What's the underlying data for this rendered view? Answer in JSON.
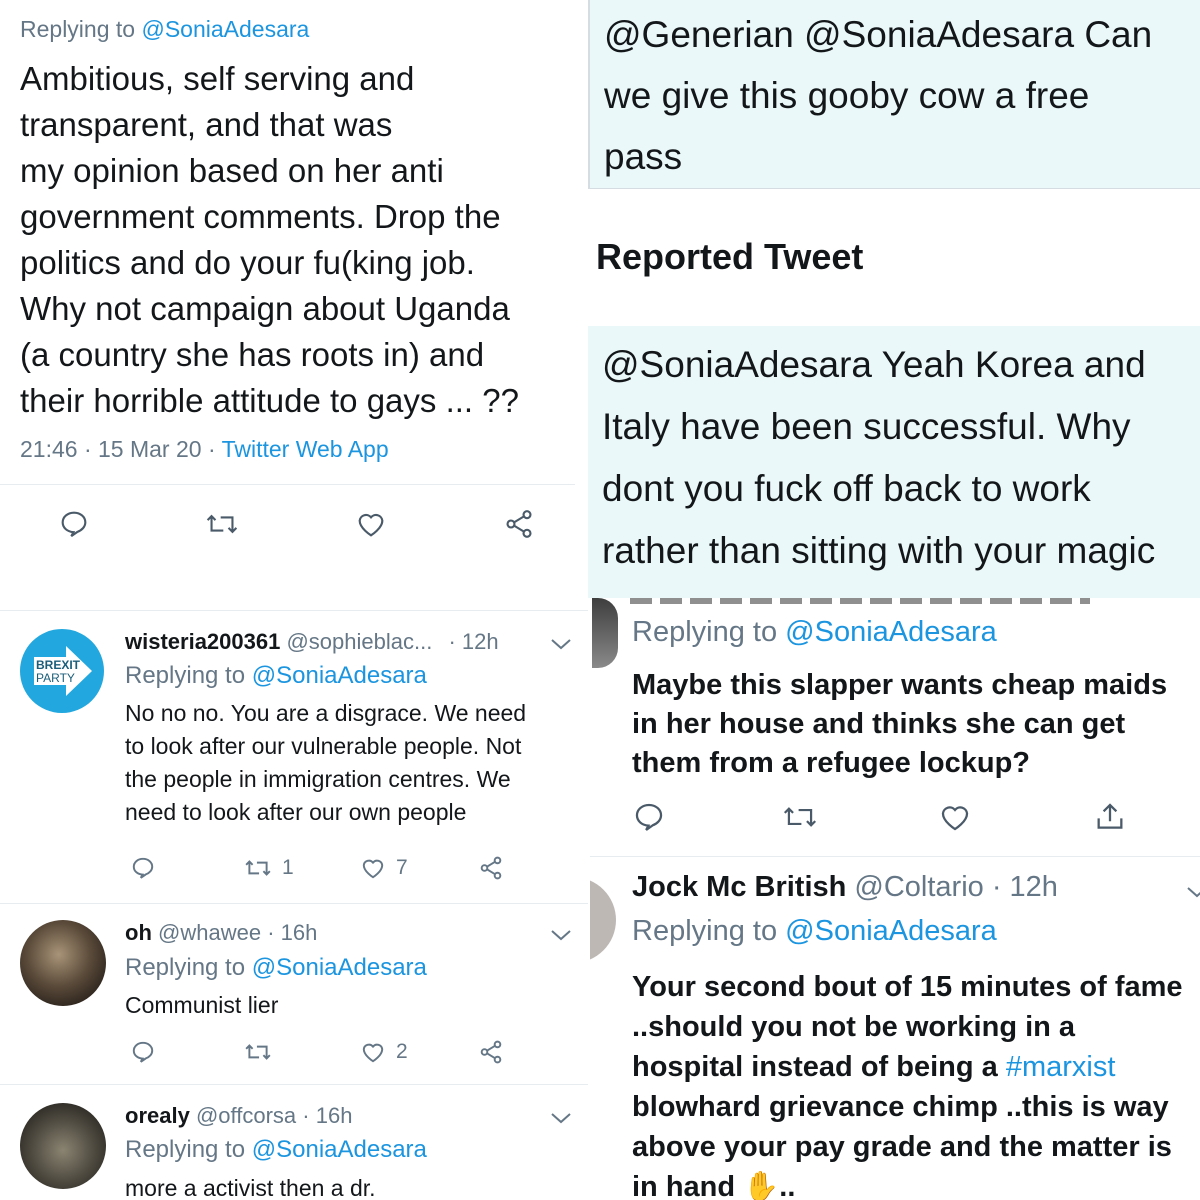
{
  "top_left": {
    "replying_prefix": "Replying to",
    "replying_handle": "@SoniaAdesara",
    "lines": [
      "Ambitious, self serving and",
      "transparent, and that was",
      "my opinion based on her anti",
      "government comments. Drop the",
      "politics and do your fu(king job.",
      "Why not campaign about Uganda",
      "(a country she has roots in) and",
      "their horrible attitude to gays ... ??"
    ],
    "time": "21:46 · 15 Mar 20 · ",
    "client": "Twitter Web App"
  },
  "top_right": {
    "lines": [
      "@Generian @SoniaAdesara Can",
      "we give this gooby cow a free",
      "pass"
    ],
    "reported_heading": "Reported Tweet",
    "reported_lines": [
      "@SoniaAdesara Yeah Korea and",
      "Italy have been successful. Why",
      "dont you fuck off back to work",
      "rather than sitting with your magic"
    ]
  },
  "feed_left": [
    {
      "name": "wisteria200361",
      "handle": "@sophieblac...",
      "time": "· 12h",
      "replying_prefix": "Replying to",
      "replying_handle": "@SoniaAdesara",
      "lines": [
        "No no no.  You are a disgrace. We need",
        "to look after our vulnerable people. Not",
        "the people in immigration centres. We",
        "need to look after our own people"
      ],
      "retweets": "1",
      "likes": "7",
      "avatar_text_1": "BREXIT",
      "avatar_text_2": "PARTY"
    },
    {
      "name": "oh",
      "handle": "@whawee",
      "time": "· 16h",
      "replying_prefix": "Replying to",
      "replying_handle": "@SoniaAdesara",
      "lines": [
        "Communist lier"
      ],
      "likes": "2"
    },
    {
      "name": "orealy",
      "handle": "@offcorsa",
      "time": "· 16h",
      "replying_prefix": "Replying to",
      "replying_handle": "@SoniaAdesara",
      "lines": [
        "more a activist then a  dr."
      ]
    }
  ],
  "feed_right": [
    {
      "replying_prefix": "Replying to",
      "replying_handle": "@SoniaAdesara",
      "lines": [
        "Maybe this slapper wants cheap maids",
        "in her house and thinks she can get",
        "them from a refugee lockup?"
      ]
    },
    {
      "name": "Jock Mc British",
      "handle": "@Coltario · 12h",
      "replying_prefix": "Replying to",
      "replying_handle": "@SoniaAdesara",
      "line1": "Your second bout of 15 minutes of fame",
      "line2": "..should you not be working in a",
      "line3_a": "hospital instead of being a ",
      "line3_hashtag": "#marxist",
      "line4": "blowhard grievance chimp ..this is way",
      "line5": "above your pay grade and the matter is",
      "line6_text": "in hand",
      "line6_emoji": "✋",
      "line6_tail": ".."
    }
  ],
  "colors": {
    "link": "#1b95e0",
    "muted": "#657786",
    "reported_bg": "#eaf8fa"
  }
}
